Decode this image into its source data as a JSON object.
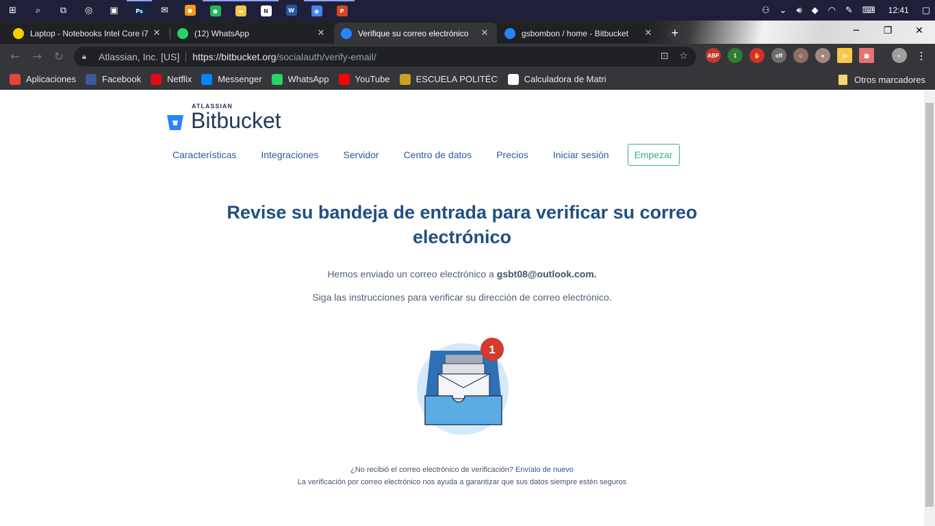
{
  "taskbar": {
    "apps": [
      {
        "icon": "windows-start-icon",
        "glyph": "⊞"
      },
      {
        "icon": "search-icon",
        "glyph": "⌕"
      },
      {
        "icon": "task-view-icon",
        "glyph": "⧉"
      },
      {
        "icon": "groove-icon",
        "glyph": "◎"
      },
      {
        "icon": "store-icon",
        "glyph": "▣"
      },
      {
        "icon": "photoshop-icon",
        "glyph": "Ps"
      },
      {
        "icon": "mail-icon",
        "glyph": "✉"
      },
      {
        "icon": "app-orange-icon",
        "glyph": "●"
      },
      {
        "icon": "spotify-icon",
        "glyph": "●"
      },
      {
        "icon": "file-explorer-icon",
        "glyph": "▬"
      },
      {
        "icon": "app-chart-icon",
        "glyph": "N"
      },
      {
        "icon": "word-icon",
        "glyph": "W"
      },
      {
        "icon": "chrome-icon",
        "glyph": "◉"
      },
      {
        "icon": "powerpoint-icon",
        "glyph": "P"
      }
    ],
    "clock": "12:41"
  },
  "tabs": [
    {
      "title": "Laptop - Notebooks Intel Core i7",
      "favicon_color": "#f5d000",
      "close": "✕"
    },
    {
      "title": "(12) WhatsApp",
      "favicon_color": "#25d366",
      "close": "✕"
    },
    {
      "title": "Verifique su correo electrónico",
      "favicon_color": "#2684ff",
      "close": "✕"
    },
    {
      "title": "gsbombon / home - Bitbucket",
      "favicon_color": "#2684ff",
      "close": "✕"
    }
  ],
  "toolbar": {
    "cert_org": "Atlassian, Inc. [US]",
    "url_host": "https://bitbucket.org",
    "url_path": "/socialauth/verify-email/"
  },
  "bookmarks": [
    {
      "label": "Aplicaciones",
      "icon": "apps-grid-icon",
      "color": "#e8453c"
    },
    {
      "label": "Facebook",
      "icon": "facebook-icon",
      "color": "#3b5998"
    },
    {
      "label": "Netflix",
      "icon": "netflix-icon",
      "color": "#e50914"
    },
    {
      "label": "Messenger",
      "icon": "messenger-icon",
      "color": "#0084ff"
    },
    {
      "label": "WhatsApp",
      "icon": "whatsapp-icon",
      "color": "#25d366"
    },
    {
      "label": "YouTube",
      "icon": "youtube-icon",
      "color": "#ff0000"
    },
    {
      "label": "ESCUELA POLITÉCNIC",
      "icon": "escuela-icon",
      "color": "#c9a227"
    },
    {
      "label": "Calculadora de Matric",
      "icon": "calculator-icon",
      "color": "#ffffff"
    }
  ],
  "bookmarks_other": "Otros marcadores",
  "brand": {
    "atlassian": "ATLASSIAN",
    "product": "Bitbucket",
    "color": "#2684ff"
  },
  "nav": {
    "items": [
      "Características",
      "Integraciones",
      "Servidor",
      "Centro de datos",
      "Precios",
      "Iniciar sesión"
    ],
    "cta": "Empezar"
  },
  "content": {
    "headline_line1": "Revise su bandeja de entrada para verificar su correo",
    "headline_line2": "electrónico",
    "sent_prefix": "Hemos enviado un correo electrónico a ",
    "email": "gsbt08@outlook.com.",
    "instructions": "Siga las instrucciones para verificar su dirección de correo electrónico.",
    "badge_count": "1",
    "footer_question": "¿No recibió el correo electrónico de verificación?",
    "footer_link": "Envíalo de nuevo",
    "footer_note": "La verificación por correo electrónico nos ayuda a garantizar que sus datos siempre estén seguros"
  }
}
